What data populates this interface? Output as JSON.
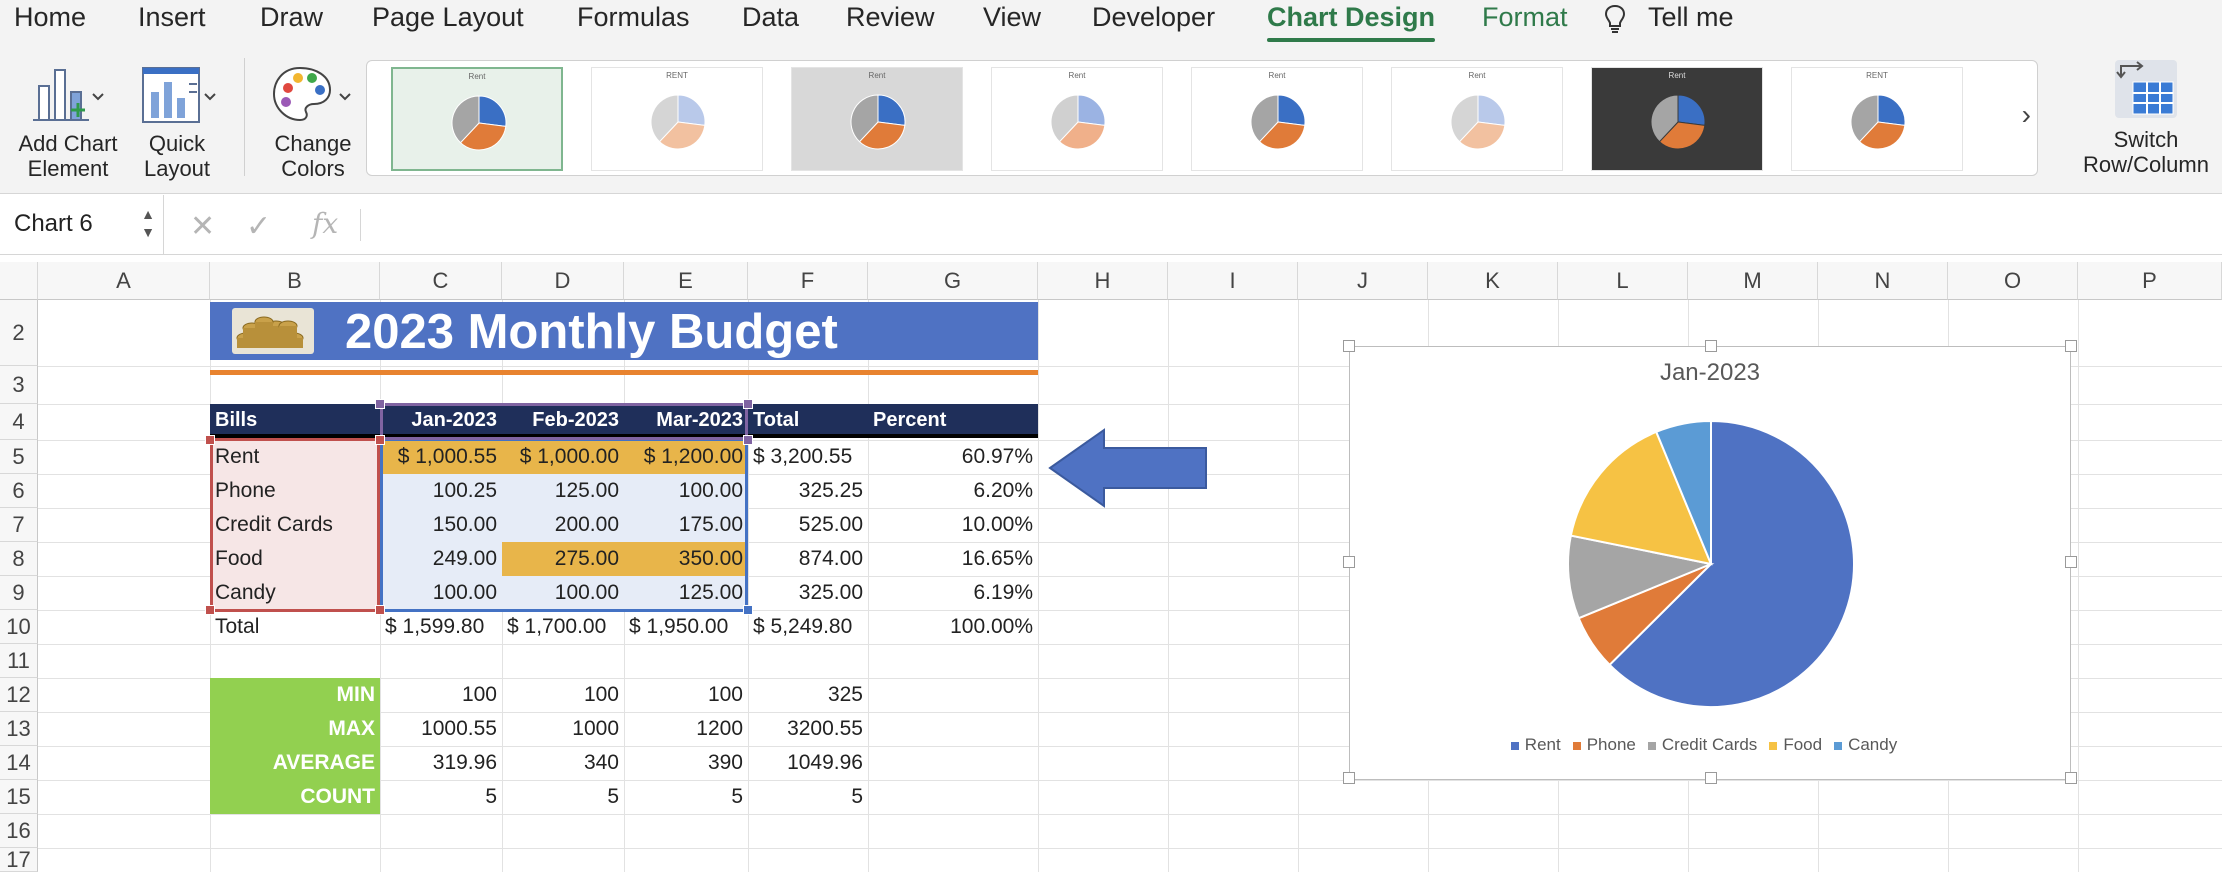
{
  "ribbon_tabs": [
    "Home",
    "Insert",
    "Draw",
    "Page Layout",
    "Formulas",
    "Data",
    "Review",
    "View",
    "Developer",
    "Chart Design",
    "Format",
    "Tell me"
  ],
  "active_tab": "Chart Design",
  "ribbon_buttons": {
    "add_chart_element": "Add Chart\nElement",
    "quick_layout": "Quick\nLayout",
    "change_colors": "Change\nColors",
    "switch_row_column": "Switch\nRow/Column"
  },
  "chart_styles": [
    {
      "title": "Rent",
      "variant": "plain",
      "selected": true
    },
    {
      "title": "RENT",
      "variant": "hatched"
    },
    {
      "title": "Rent",
      "variant": "gray-bg"
    },
    {
      "title": "Rent",
      "variant": "pale"
    },
    {
      "title": "Rent",
      "variant": "plain"
    },
    {
      "title": "Rent",
      "variant": "hatched-bg"
    },
    {
      "title": "Rent",
      "variant": "dark"
    },
    {
      "title": "RENT",
      "variant": "labeled"
    }
  ],
  "name_box": "Chart 6",
  "formula_bar": {
    "value": ""
  },
  "columns": [
    "A",
    "B",
    "C",
    "D",
    "E",
    "F",
    "G",
    "H",
    "I",
    "J",
    "K",
    "L",
    "M",
    "N",
    "O",
    "P"
  ],
  "rows": [
    "2",
    "3",
    "4",
    "5",
    "6",
    "7",
    "8",
    "9",
    "10",
    "11",
    "12",
    "13",
    "14",
    "15",
    "16",
    "17"
  ],
  "sheet": {
    "title": "2023 Monthly Budget",
    "headers": [
      "Bills",
      "Jan-2023",
      "Feb-2023",
      "Mar-2023",
      "Total",
      "Percent"
    ],
    "bills": [
      {
        "name": "Rent",
        "jan": "$ 1,000.55",
        "feb": "$ 1,000.00",
        "mar": "$ 1,200.00",
        "total": "$ 3,200.55",
        "percent": "60.97%"
      },
      {
        "name": "Phone",
        "jan": "100.25",
        "feb": "125.00",
        "mar": "100.00",
        "total": "325.25",
        "percent": "6.20%"
      },
      {
        "name": "Credit Cards",
        "jan": "150.00",
        "feb": "200.00",
        "mar": "175.00",
        "total": "525.00",
        "percent": "10.00%"
      },
      {
        "name": "Food",
        "jan": "249.00",
        "feb": "275.00",
        "mar": "350.00",
        "total": "874.00",
        "percent": "16.65%"
      },
      {
        "name": "Candy",
        "jan": "100.00",
        "feb": "100.00",
        "mar": "125.00",
        "total": "325.00",
        "percent": "6.19%"
      }
    ],
    "total_row": {
      "label": "Total",
      "jan": "$ 1,599.80",
      "feb": "$ 1,700.00",
      "mar": "$ 1,950.00",
      "total": "$ 5,249.80",
      "percent": "100.00%"
    },
    "stats": [
      {
        "label": "MIN",
        "jan": "100",
        "feb": "100",
        "mar": "100",
        "total": "325"
      },
      {
        "label": "MAX",
        "jan": "1000.55",
        "feb": "1000",
        "mar": "1200",
        "total": "3200.55"
      },
      {
        "label": "AVERAGE",
        "jan": "319.96",
        "feb": "340",
        "mar": "390",
        "total": "1049.96"
      },
      {
        "label": "COUNT",
        "jan": "5",
        "feb": "5",
        "mar": "5",
        "total": "5"
      }
    ]
  },
  "colors": {
    "title_banner": "#4f72c3",
    "title_underline": "#e8832f",
    "header_row": "#1f2f5a",
    "stats_green": "#92d050",
    "highlight_gold": "#e8b54a",
    "rent_row_gold": "#e8b54a",
    "bills_range_fill": "#f6e6e6",
    "values_range_fill": "#e6ecf7",
    "arrow": "#4f72c3"
  },
  "chart_data": {
    "type": "pie",
    "title": "Jan-2023",
    "categories": [
      "Rent",
      "Phone",
      "Credit Cards",
      "Food",
      "Candy"
    ],
    "values": [
      1000.55,
      100.25,
      150.0,
      249.0,
      100.0
    ],
    "colors": [
      "#4f72c3",
      "#e07b39",
      "#a5a5a5",
      "#f6c244",
      "#5b9bd5"
    ],
    "legend": "bottom"
  }
}
